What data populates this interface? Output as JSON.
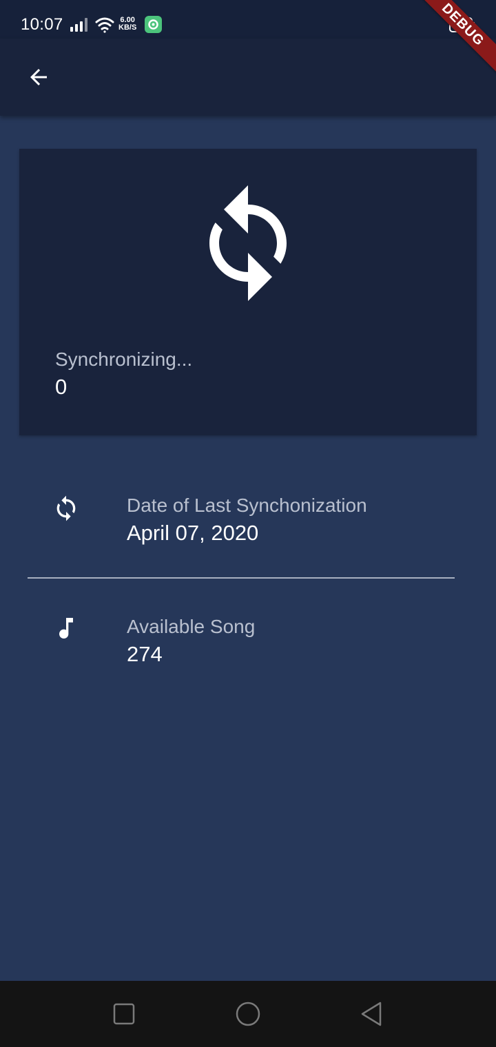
{
  "status_bar": {
    "time": "10:07",
    "net_speed_value": "6.00",
    "net_speed_unit": "KB/S",
    "icons": [
      "signal-icon",
      "wifi-icon",
      "app-notification-icon",
      "battery-icon"
    ]
  },
  "app_bar": {
    "back_icon": "arrow-back-icon",
    "debug_banner": "DEBUG"
  },
  "sync_card": {
    "icon": "sync-icon",
    "status_text": "Synchronizing...",
    "count": "0"
  },
  "info_rows": [
    {
      "icon": "sync-icon",
      "label": "Date of Last Synchonization",
      "value": "April 07, 2020"
    },
    {
      "icon": "music-note-icon",
      "label": "Available Song",
      "value": "274"
    }
  ],
  "nav_bar": {
    "buttons": [
      "recents-square-icon",
      "home-circle-icon",
      "back-triangle-icon"
    ]
  },
  "colors": {
    "background": "#263759",
    "app_bar": "#19233c",
    "card": "#19233c",
    "status_bar": "#16213a",
    "label_text": "#b9c0cf",
    "value_text": "#ffffff",
    "debug_ribbon": "#8b1a1a",
    "nav_bar": "#141414"
  }
}
